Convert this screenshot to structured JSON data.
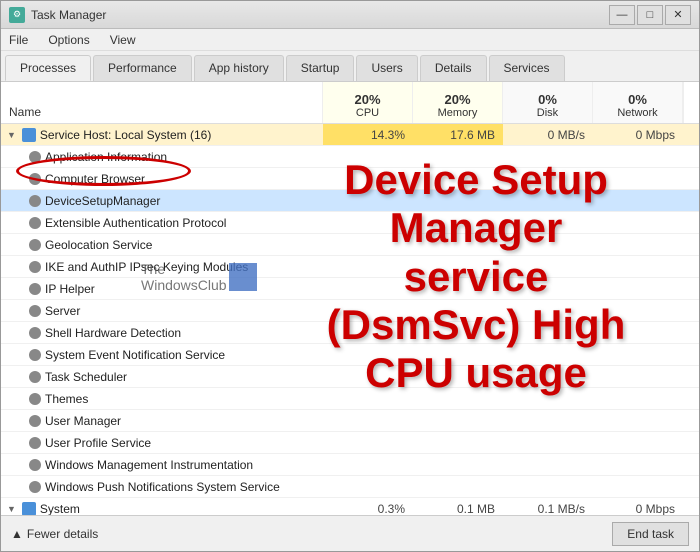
{
  "window": {
    "title": "Task Manager",
    "controls": {
      "minimize": "—",
      "maximize": "□",
      "close": "✕"
    }
  },
  "menu": {
    "items": [
      "File",
      "Options",
      "View"
    ]
  },
  "tabs": {
    "list": [
      "Processes",
      "Performance",
      "App history",
      "Startup",
      "Users",
      "Details",
      "Services"
    ],
    "active": 0
  },
  "table": {
    "headers": {
      "name": "Name",
      "cpu": {
        "pct": "20%",
        "label": "CPU"
      },
      "memory": {
        "pct": "20%",
        "label": "Memory"
      },
      "disk": {
        "pct": "0%",
        "label": "Disk"
      },
      "network": {
        "pct": "0%",
        "label": "Network"
      }
    },
    "rows": [
      {
        "type": "group",
        "indent": 0,
        "name": "Service Host: Local System (16)",
        "cpu": "14.3%",
        "memory": "17.6 MB",
        "disk": "0 MB/s",
        "network": "0 Mbps",
        "highlighted": true
      },
      {
        "type": "child",
        "indent": 1,
        "name": "Application Information",
        "cpu": "",
        "memory": "",
        "disk": "",
        "network": ""
      },
      {
        "type": "child",
        "indent": 1,
        "name": "Computer Browser",
        "cpu": "",
        "memory": "",
        "disk": "",
        "network": ""
      },
      {
        "type": "child",
        "indent": 1,
        "name": "DeviceSetupManager",
        "cpu": "",
        "memory": "",
        "disk": "",
        "network": "",
        "selected": true
      },
      {
        "type": "child",
        "indent": 1,
        "name": "Extensible Authentication Protocol",
        "cpu": "",
        "memory": "",
        "disk": "",
        "network": ""
      },
      {
        "type": "child",
        "indent": 1,
        "name": "Geolocation Service",
        "cpu": "",
        "memory": "",
        "disk": "",
        "network": ""
      },
      {
        "type": "child",
        "indent": 1,
        "name": "IKE and AuthIP IPsec Keying Modules",
        "cpu": "",
        "memory": "",
        "disk": "",
        "network": ""
      },
      {
        "type": "child",
        "indent": 1,
        "name": "IP Helper",
        "cpu": "",
        "memory": "",
        "disk": "",
        "network": ""
      },
      {
        "type": "child",
        "indent": 1,
        "name": "Server",
        "cpu": "",
        "memory": "",
        "disk": "",
        "network": ""
      },
      {
        "type": "child",
        "indent": 1,
        "name": "Shell Hardware Detection",
        "cpu": "",
        "memory": "",
        "disk": "",
        "network": ""
      },
      {
        "type": "child",
        "indent": 1,
        "name": "System Event Notification Service",
        "cpu": "",
        "memory": "",
        "disk": "",
        "network": ""
      },
      {
        "type": "child",
        "indent": 1,
        "name": "Task Scheduler",
        "cpu": "",
        "memory": "",
        "disk": "",
        "network": ""
      },
      {
        "type": "child",
        "indent": 1,
        "name": "Themes",
        "cpu": "",
        "memory": "",
        "disk": "",
        "network": ""
      },
      {
        "type": "child",
        "indent": 1,
        "name": "User Manager",
        "cpu": "",
        "memory": "",
        "disk": "",
        "network": ""
      },
      {
        "type": "child",
        "indent": 1,
        "name": "User Profile Service",
        "cpu": "",
        "memory": "",
        "disk": "",
        "network": ""
      },
      {
        "type": "child",
        "indent": 1,
        "name": "Windows Management Instrumentation",
        "cpu": "",
        "memory": "",
        "disk": "",
        "network": ""
      },
      {
        "type": "child",
        "indent": 1,
        "name": "Windows Push Notifications System Service",
        "cpu": "",
        "memory": "",
        "disk": "",
        "network": ""
      },
      {
        "type": "group",
        "indent": 0,
        "name": "System",
        "cpu": "0.3%",
        "memory": "0.1 MB",
        "disk": "0.1 MB/s",
        "network": "0 Mbps",
        "highlighted": false
      }
    ]
  },
  "overlay": {
    "text": "Device Setup\nManager\nservice\n(DsmSvc) High\nCPU usage"
  },
  "watermark": {
    "text": "The\nWindowsClub"
  },
  "bottom": {
    "fewer_details": "Fewer details",
    "end_task": "End task"
  }
}
